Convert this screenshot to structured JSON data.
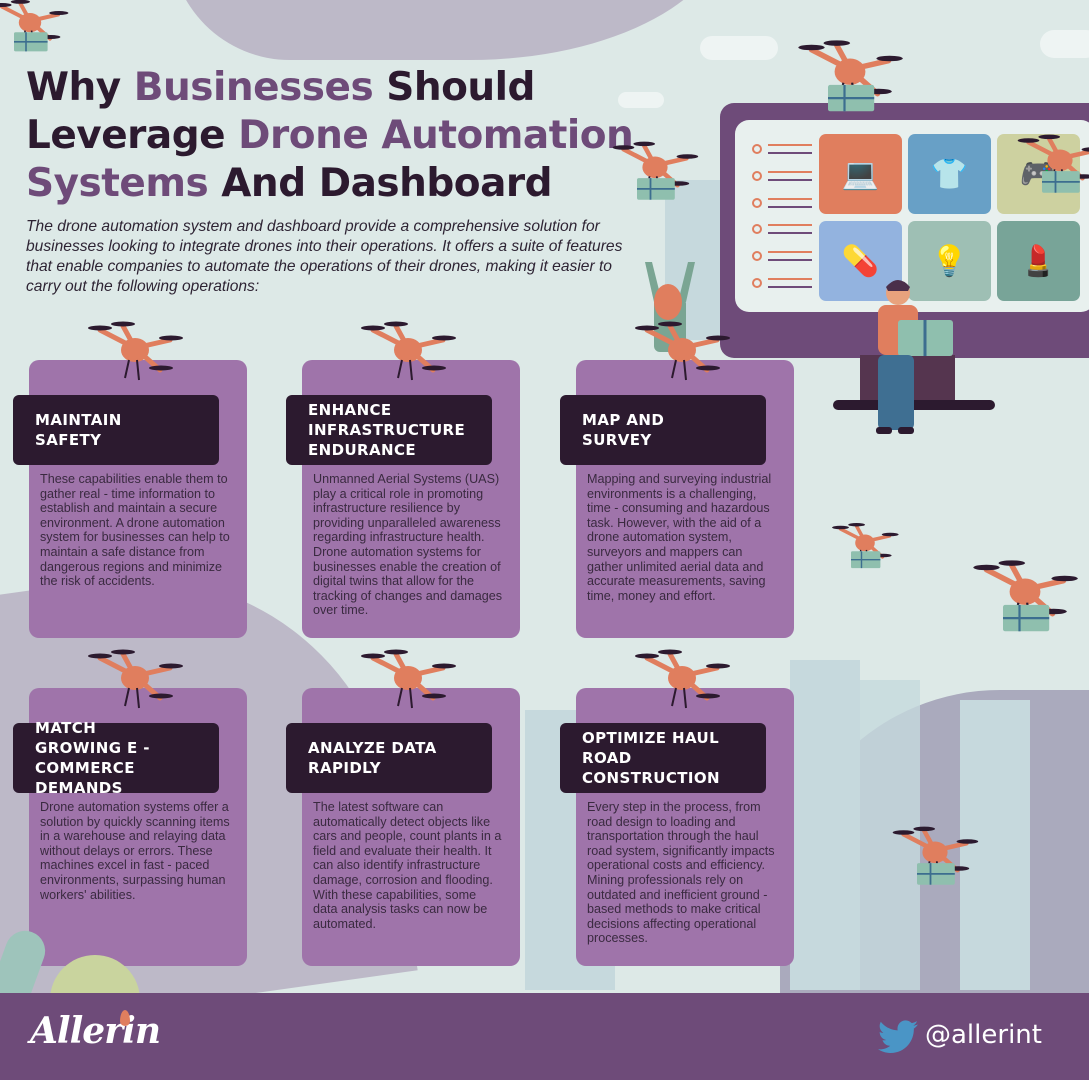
{
  "header": {
    "title_parts": [
      {
        "text": "Why ",
        "accent": false
      },
      {
        "text": "Businesses",
        "accent": true
      },
      {
        "text": " Should ",
        "accent": false
      },
      {
        "text": "Leverage ",
        "accent": false
      },
      {
        "text": "Drone Automation",
        "accent": true
      },
      {
        "text": "Systems",
        "accent": true
      },
      {
        "text": " And Dashboard",
        "accent": false
      }
    ],
    "title_line1_a": "Why ",
    "title_line1_b": "Businesses",
    "title_line1_c": " Should",
    "title_line2_a": "Leverage ",
    "title_line2_b": "Drone Automation",
    "title_line3_a": "Systems",
    "title_line3_b": " And Dashboard",
    "intro": "The drone automation system and dashboard provide a comprehensive solution for businesses looking to integrate drones into their operations. It offers a suite of features that enable companies to automate the operations of their drones, making it easier to carry out the following operations:"
  },
  "cards": [
    {
      "title": "MAINTAIN SAFETY",
      "body": "These capabilities enable them to gather real - time information to establish and maintain a secure environment. A drone automation system for businesses can help to maintain a safe distance from dangerous regions and minimize the risk of accidents."
    },
    {
      "title": "ENHANCE INFRASTRUCTURE ENDURANCE",
      "body": "Unmanned Aerial Systems (UAS) play a critical role in promoting infrastructure resilience by providing unparalleled awareness regarding infrastructure health. Drone automation systems for businesses enable the creation of digital twins that allow for the tracking of changes and damages over time."
    },
    {
      "title": "MAP AND SURVEY",
      "body": "Mapping and surveying industrial environments is a challenging, time - consuming and hazardous task. However, with the aid of a drone automation system, surveyors and mappers can gather unlimited aerial data and accurate measurements, saving time, money and effort."
    },
    {
      "title": "MATCH GROWING E - COMMERCE DEMANDS",
      "body": "Drone automation systems offer a solution by quickly scanning items in a warehouse and relaying data without delays or errors. These machines excel in fast - paced environments, surpassing human workers' abilities."
    },
    {
      "title": "ANALYZE DATA RAPIDLY",
      "body": "The latest software can automatically detect objects like cars and people, count plants in a field and evaluate their health. It can also identify infrastructure damage, corrosion and flooding. With these capabilities, some data analysis tasks can now be automated."
    },
    {
      "title": "OPTIMIZE HAUL ROAD CONSTRUCTION",
      "body": "Every step in the process, from road design to loading and transportation through the haul road system, significantly impacts operational costs and efficiency. Mining professionals rely on outdated and inefficient ground - based methods to make critical decisions affecting operational processes."
    }
  ],
  "dashboard_illustration": {
    "tiles": [
      {
        "icon": "laptop-icon",
        "glyph": "💻",
        "color": "#e07e5e"
      },
      {
        "icon": "tshirt-icon",
        "glyph": "👕",
        "color": "#68a0c6"
      },
      {
        "icon": "gamepad-icon",
        "glyph": "🎮",
        "color": "#cdd1a0"
      },
      {
        "icon": "pills-icon",
        "glyph": "💊",
        "color": "#93b3df"
      },
      {
        "icon": "lamp-icon",
        "glyph": "💡",
        "color": "#9ebfb4"
      },
      {
        "icon": "lipstick-icon",
        "glyph": "💄",
        "color": "#78a498"
      }
    ]
  },
  "footer": {
    "brand": "Allerin",
    "twitter_handle": "@allerint"
  },
  "colors": {
    "background": "#dde9e7",
    "accent_purple": "#6e4b79",
    "card_purple": "#9f74aa",
    "dark": "#2c1a2f",
    "drone_orange": "#e07e5e",
    "package_green": "#8fbfae",
    "twitter_blue": "#4a95c6"
  }
}
